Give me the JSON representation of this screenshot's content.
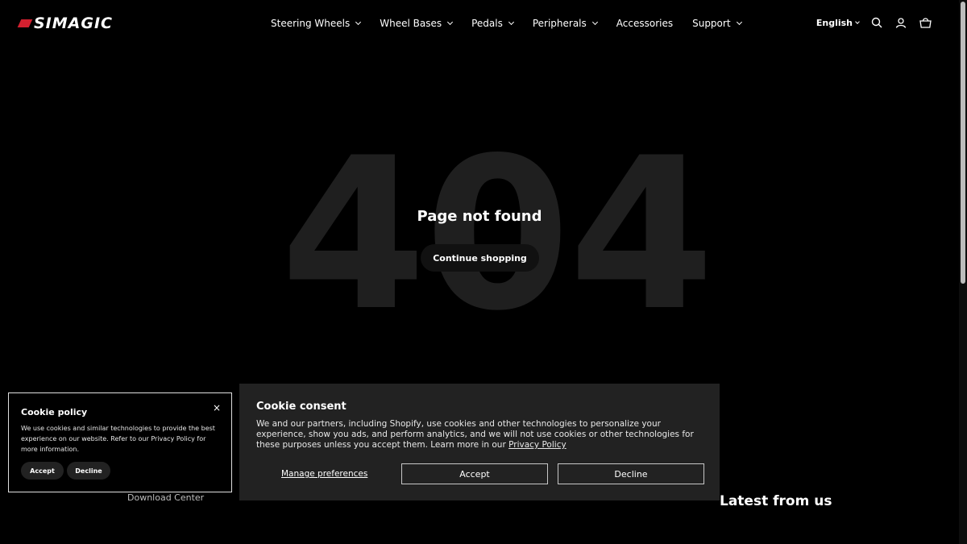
{
  "header": {
    "logo_text": "SIMAGIC",
    "nav": [
      {
        "label": "Steering Wheels",
        "has_dropdown": true
      },
      {
        "label": "Wheel Bases",
        "has_dropdown": true
      },
      {
        "label": "Pedals",
        "has_dropdown": true
      },
      {
        "label": "Peripherals",
        "has_dropdown": true
      },
      {
        "label": "Accessories",
        "has_dropdown": false
      },
      {
        "label": "Support",
        "has_dropdown": true
      }
    ],
    "language": "English",
    "icons": [
      "search-icon",
      "account-icon",
      "cart-icon"
    ]
  },
  "main": {
    "background_number": "404",
    "title": "Page not found",
    "continue_label": "Continue shopping"
  },
  "footer": {
    "link": "Download Center",
    "heading_partial": "Latest from us"
  },
  "cookie_policy": {
    "title": "Cookie policy",
    "text": "We use cookies and similar technologies to provide the best experience on our website. Refer to our Privacy Policy for more information.",
    "accept_label": "Accept",
    "decline_label": "Decline",
    "close_glyph": "×"
  },
  "cookie_consent": {
    "title": "Cookie consent",
    "text": "We and our partners, including Shopify, use cookies and other technologies to personalize your experience, show you ads, and perform analytics, and we will not use cookies or other technologies for these purposes unless you accept them. Learn more in our ",
    "privacy_link": "Privacy Policy",
    "manage_label": "Manage preferences",
    "accept_label": "Accept",
    "decline_label": "Decline"
  },
  "colors": {
    "background": "#000000",
    "brand_red": "#d3202f",
    "consent_panel": "#222222",
    "digit_gray": "#1f1f1f"
  }
}
